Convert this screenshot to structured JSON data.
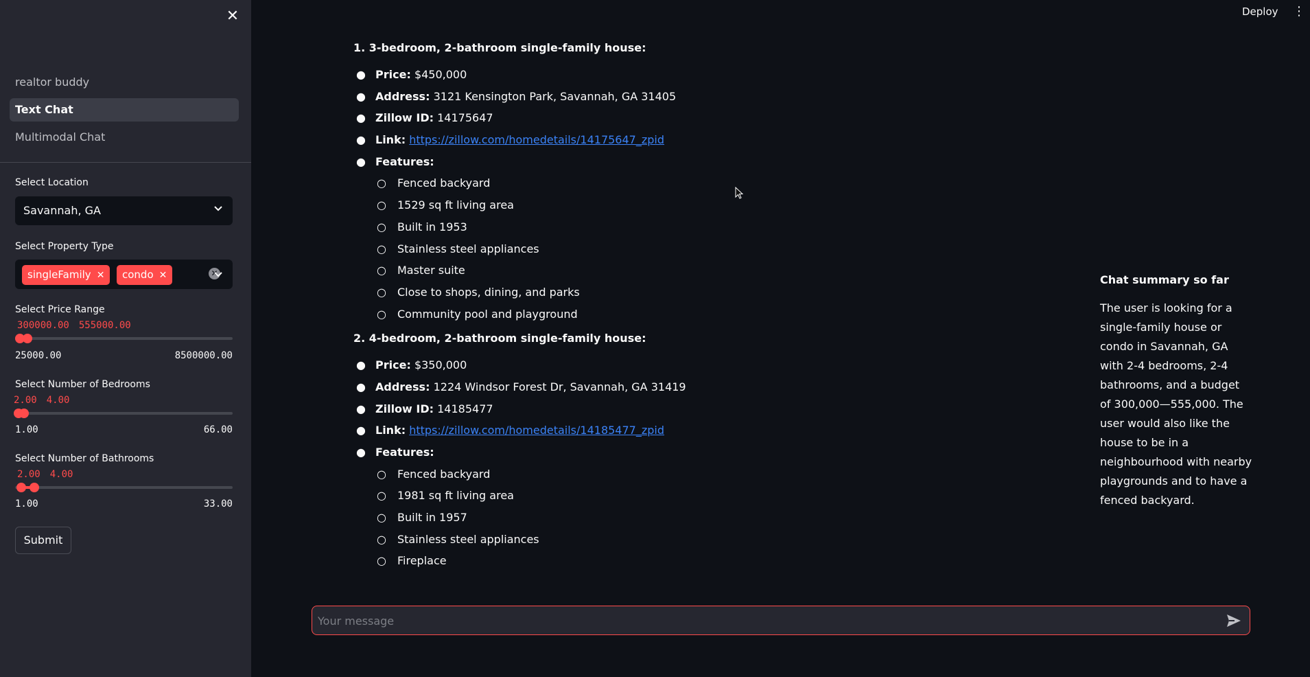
{
  "header": {
    "deploy_label": "Deploy",
    "menu_icon": "kebab-menu-icon"
  },
  "sidebar": {
    "close_icon": "close-icon",
    "nav": [
      {
        "label": "realtor buddy"
      },
      {
        "label": "Text Chat",
        "active": true
      },
      {
        "label": "Multimodal Chat"
      }
    ],
    "location": {
      "label": "Select Location",
      "value": "Savannah, GA"
    },
    "property_type": {
      "label": "Select Property Type",
      "chips": [
        "singleFamily",
        "condo"
      ]
    },
    "price": {
      "label": "Select Price Range",
      "low": "300000.00",
      "high": "555000.00",
      "min": "25000.00",
      "max": "8500000.00"
    },
    "bedrooms": {
      "label": "Select Number of Bedrooms",
      "low": "2.00",
      "high": "4.00",
      "min": "1.00",
      "max": "66.00"
    },
    "bathrooms": {
      "label": "Select Number of Bathrooms",
      "low": "2.00",
      "high": "4.00",
      "min": "1.00",
      "max": "33.00"
    },
    "submit_label": "Submit"
  },
  "main": {
    "listings": [
      {
        "heading": "1. 3-bedroom, 2-bathroom single-family house:",
        "price_label": "Price:",
        "price": "$450,000",
        "address_label": "Address:",
        "address": "3121 Kensington Park, Savannah, GA 31405",
        "zillow_label": "Zillow ID:",
        "zillow_id": "14175647",
        "link_label": "Link:",
        "link": "https://zillow.com/homedetails/14175647_zpid",
        "features_label": "Features:",
        "features": [
          "Fenced backyard",
          "1529 sq ft living area",
          "Built in 1953",
          "Stainless steel appliances",
          "Master suite",
          "Close to shops, dining, and parks",
          "Community pool and playground"
        ]
      },
      {
        "heading": "2. 4-bedroom, 2-bathroom single-family house:",
        "price_label": "Price:",
        "price": "$350,000",
        "address_label": "Address:",
        "address": "1224 Windsor Forest Dr, Savannah, GA 31419",
        "zillow_label": "Zillow ID:",
        "zillow_id": "14185477",
        "link_label": "Link:",
        "link": "https://zillow.com/homedetails/14185477_zpid",
        "features_label": "Features:",
        "features": [
          "Fenced backyard",
          "1981 sq ft living area",
          "Built in 1957",
          "Stainless steel appliances",
          "Fireplace"
        ]
      }
    ]
  },
  "summary": {
    "title": "Chat summary so far",
    "body": "The user is looking for a single-family house or condo in Savannah, GA with 2-4 bedrooms, 2-4 bathrooms, and a budget of 300,000—555,000. The user would also like the house to be in a neighbourhood with nearby playgrounds and to have a fenced backyard."
  },
  "chat": {
    "placeholder": "Your message",
    "send_icon": "send-icon"
  },
  "colors": {
    "accent": "#ff4b4b",
    "background": "#0e1117",
    "sidebar": "#262730",
    "link": "#3b82f6"
  }
}
